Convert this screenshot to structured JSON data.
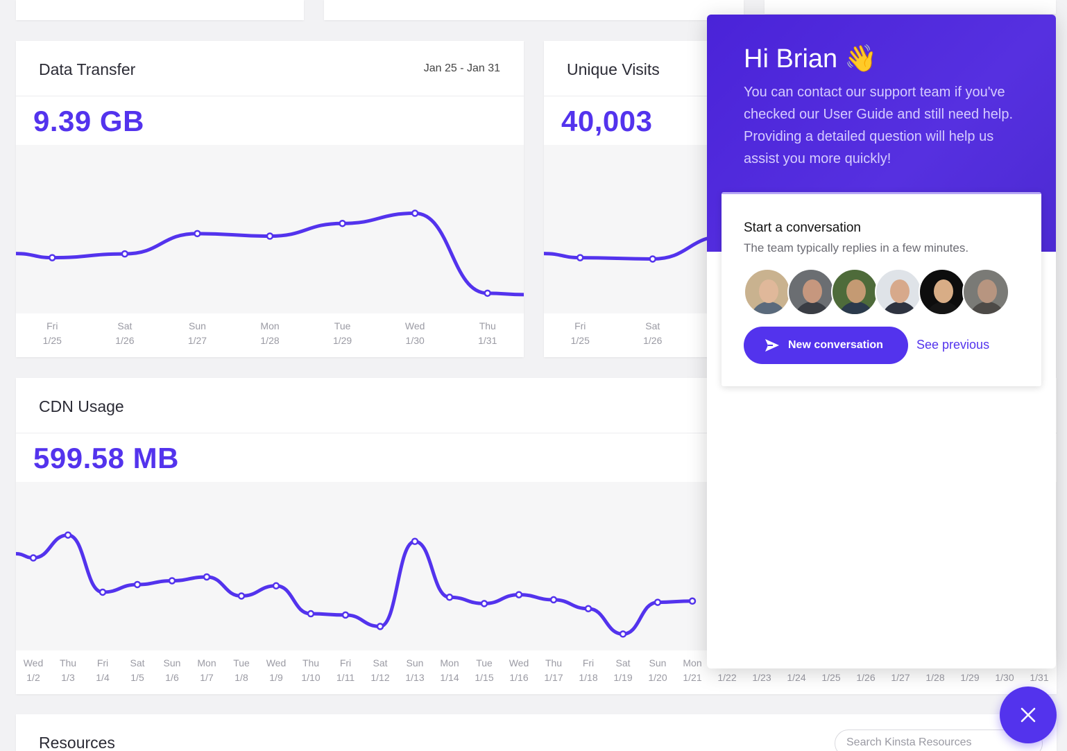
{
  "data_transfer": {
    "title": "Data Transfer",
    "range": "Jan 25 - Jan 31",
    "value": "9.39 GB",
    "ticks": [
      {
        "day": "Fri",
        "date": "1/25"
      },
      {
        "day": "Sat",
        "date": "1/26"
      },
      {
        "day": "Sun",
        "date": "1/27"
      },
      {
        "day": "Mon",
        "date": "1/28"
      },
      {
        "day": "Tue",
        "date": "1/29"
      },
      {
        "day": "Wed",
        "date": "1/30"
      },
      {
        "day": "Thu",
        "date": "1/31"
      }
    ],
    "series": [
      0.33,
      0.36,
      0.52,
      0.5,
      0.6,
      0.68,
      0.05
    ]
  },
  "unique_visits": {
    "title": "Unique Visits",
    "value": "40,003",
    "ticks": [
      {
        "day": "Fri",
        "date": "1/25"
      },
      {
        "day": "Sat",
        "date": "1/26"
      }
    ],
    "series": [
      0.33,
      0.32,
      0.5
    ]
  },
  "cdn_usage": {
    "title": "CDN Usage",
    "value": "599.58 MB",
    "ticks": [
      {
        "day": "Wed",
        "date": "1/2"
      },
      {
        "day": "Thu",
        "date": "1/3"
      },
      {
        "day": "Fri",
        "date": "1/4"
      },
      {
        "day": "Sat",
        "date": "1/5"
      },
      {
        "day": "Sun",
        "date": "1/6"
      },
      {
        "day": "Mon",
        "date": "1/7"
      },
      {
        "day": "Tue",
        "date": "1/8"
      },
      {
        "day": "Wed",
        "date": "1/9"
      },
      {
        "day": "Thu",
        "date": "1/10"
      },
      {
        "day": "Fri",
        "date": "1/11"
      },
      {
        "day": "Sat",
        "date": "1/12"
      },
      {
        "day": "Sun",
        "date": "1/13"
      },
      {
        "day": "Mon",
        "date": "1/14"
      },
      {
        "day": "Tue",
        "date": "1/15"
      },
      {
        "day": "Wed",
        "date": "1/16"
      },
      {
        "day": "Thu",
        "date": "1/17"
      },
      {
        "day": "Fri",
        "date": "1/18"
      },
      {
        "day": "Sat",
        "date": "1/19"
      },
      {
        "day": "Sun",
        "date": "1/20"
      },
      {
        "day": "Mon",
        "date": "1/21"
      },
      {
        "day": "",
        "date": "1/22"
      },
      {
        "day": "",
        "date": "1/23"
      },
      {
        "day": "",
        "date": "1/24"
      },
      {
        "day": "",
        "date": "1/25"
      },
      {
        "day": "",
        "date": "1/26"
      },
      {
        "day": "",
        "date": "1/27"
      },
      {
        "day": "",
        "date": "1/28"
      },
      {
        "day": "",
        "date": "1/29"
      },
      {
        "day": "",
        "date": "1/30"
      },
      {
        "day": "",
        "date": "1/31"
      }
    ],
    "series": [
      0.62,
      0.8,
      0.35,
      0.41,
      0.44,
      0.47,
      0.32,
      0.4,
      0.18,
      0.17,
      0.08,
      0.75,
      0.31,
      0.26,
      0.33,
      0.29,
      0.22,
      0.02,
      0.27,
      0.28
    ]
  },
  "chat": {
    "greeting": "Hi Brian",
    "intro": "You can contact our support team if you've checked our User Guide and still need help. Providing a detailed question will help us assist you more quickly!",
    "convo_title": "Start a conversation",
    "convo_sub": "The team typically replies in a few minutes.",
    "new_button": "New conversation",
    "see_previous": "See previous",
    "avatar_colors": [
      {
        "bg": "#c9b28f",
        "face": "#e0b89a",
        "body": "#5a6a7c"
      },
      {
        "bg": "#6b6e72",
        "face": "#c6977e",
        "body": "#3a3d44"
      },
      {
        "bg": "#4e6b3a",
        "face": "#c49a73",
        "body": "#2b3a4c"
      },
      {
        "bg": "#dfe3e8",
        "face": "#d7a98b",
        "body": "#2e3340"
      },
      {
        "bg": "#0d0d0d",
        "face": "#d8ad86",
        "body": "#151515"
      },
      {
        "bg": "#7a7a76",
        "face": "#b79580",
        "body": "#4d4a47"
      }
    ]
  },
  "resources": {
    "title": "Resources",
    "search_placeholder": "Search Kinsta Resources"
  },
  "colors": {
    "accent": "#5333ed"
  }
}
